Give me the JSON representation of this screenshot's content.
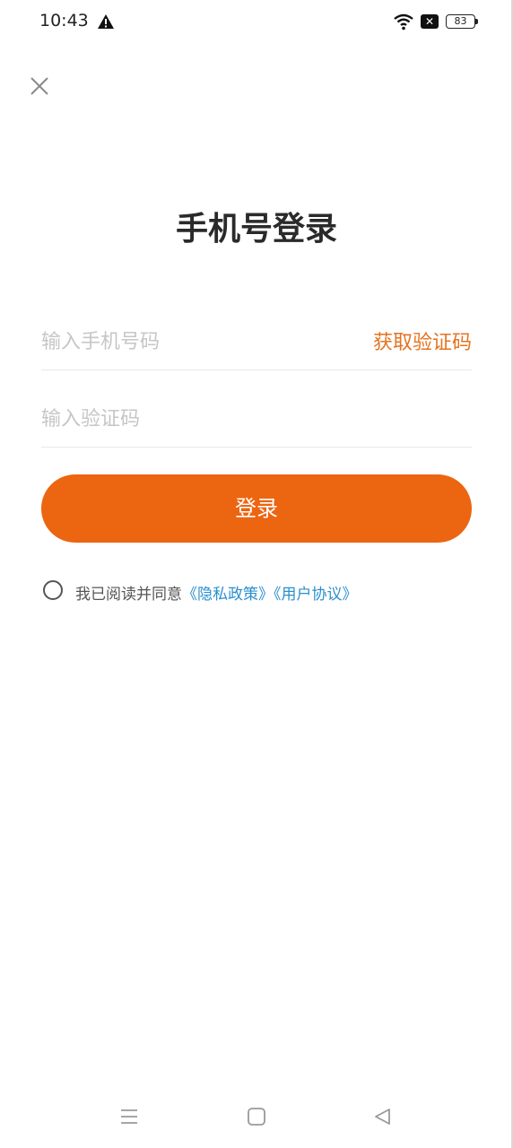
{
  "status_bar": {
    "time": "10:43",
    "battery": "83"
  },
  "title": "手机号登录",
  "phone": {
    "placeholder": "输入手机号码",
    "get_code_label": "获取验证码"
  },
  "code": {
    "placeholder": "输入验证码"
  },
  "login_button": "登录",
  "agreement": {
    "prefix": "我已阅读并同意",
    "privacy_link": "《隐私政策》",
    "terms_link": "《用户协议》"
  },
  "colors": {
    "accent": "#ec6511",
    "link": "#2a8fce",
    "get_code": "#e5731f"
  },
  "icons": [
    "alert-icon",
    "wifi-icon",
    "close-status-icon",
    "battery-icon",
    "close-icon",
    "menu-icon",
    "home-icon",
    "back-icon"
  ]
}
